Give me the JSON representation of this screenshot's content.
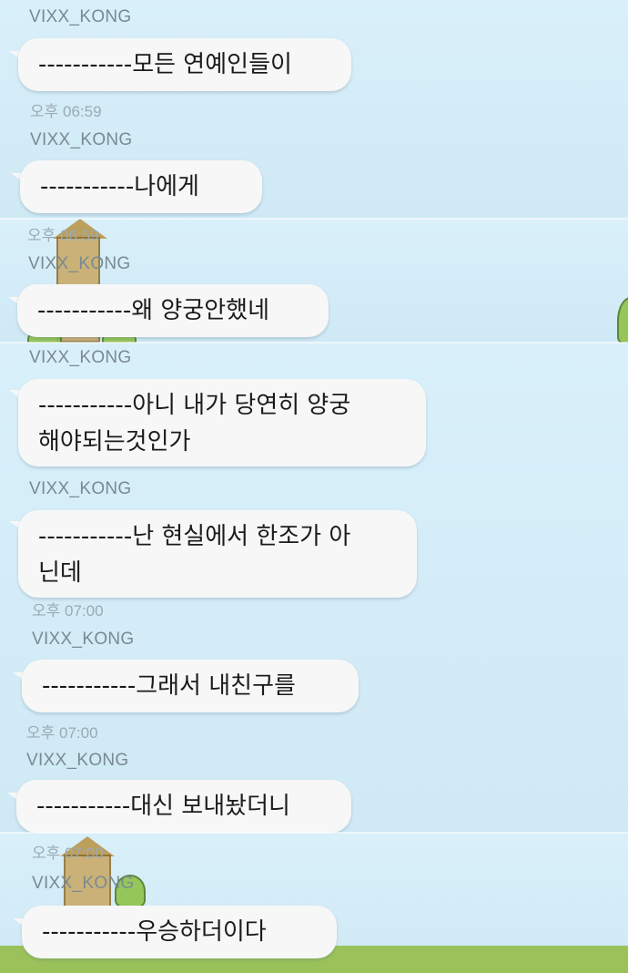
{
  "chat": {
    "messages": [
      {
        "sender": "VIXX_KONG",
        "text": "-----------모든 연예인들이",
        "time": "오후 06:59"
      },
      {
        "sender": "VIXX_KONG",
        "text": "-----------나에게",
        "time": "오후 06:59"
      },
      {
        "sender": "VIXX_KONG",
        "text": "-----------왜 양궁안했네",
        "time": ""
      },
      {
        "sender": "VIXX_KONG",
        "text": "-----------아니 내가 당연히 양궁\n해야되는것인가",
        "time": ""
      },
      {
        "sender": "VIXX_KONG",
        "text": "-----------난 현실에서 한조가 아\n닌데",
        "time": "오후 07:00"
      },
      {
        "sender": "VIXX_KONG",
        "text": "-----------그래서 내친구를",
        "time": "오후 07:00"
      },
      {
        "sender": "VIXX_KONG",
        "text": "-----------대신 보내놨더니",
        "time": "오후 07:00"
      },
      {
        "sender": "VIXX_KONG",
        "text": "-----------우승하더이다",
        "time": ""
      }
    ]
  },
  "decor": {
    "icons": [
      "castle-tower-icon",
      "bush-icon"
    ],
    "colors": {
      "background": "#cdeaf6",
      "bubble": "#f7f7f7",
      "sender_text": "#7a8a93",
      "time_text": "#9aabb4",
      "grass": "#9bc25a"
    }
  }
}
